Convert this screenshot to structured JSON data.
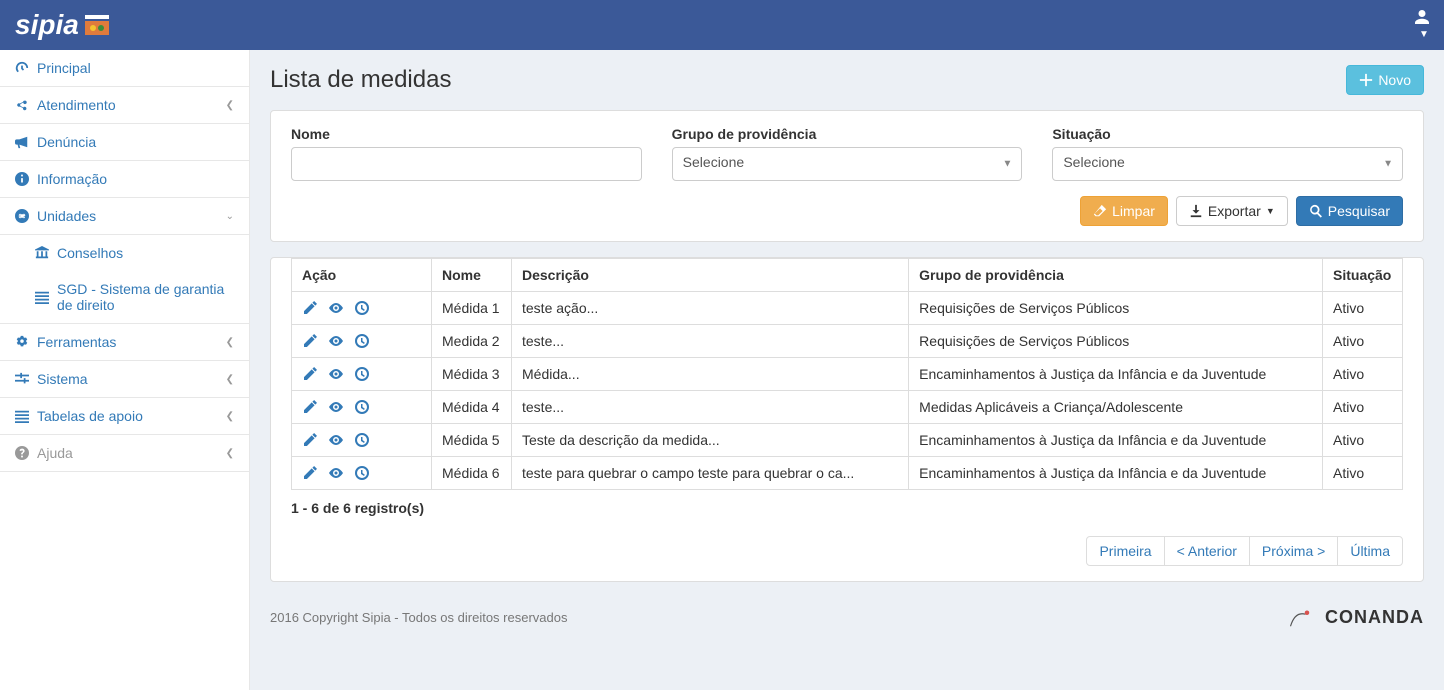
{
  "header": {
    "logo_text": "sipia"
  },
  "sidebar": {
    "principal": "Principal",
    "atendimento": "Atendimento",
    "denuncia": "Denúncia",
    "informacao": "Informação",
    "unidades": "Unidades",
    "conselhos": "Conselhos",
    "sgd": "SGD - Sistema de garantia de direito",
    "ferramentas": "Ferramentas",
    "sistema": "Sistema",
    "tabelas": "Tabelas de apoio",
    "ajuda": "Ajuda"
  },
  "page": {
    "title": "Lista de medidas",
    "novo": "Novo"
  },
  "filters": {
    "nome_label": "Nome",
    "grupo_label": "Grupo de providência",
    "situacao_label": "Situação",
    "select_placeholder": "Selecione",
    "limpar": "Limpar",
    "exportar": "Exportar",
    "pesquisar": "Pesquisar"
  },
  "table": {
    "headers": {
      "acao": "Ação",
      "nome": "Nome",
      "descricao": "Descrição",
      "grupo": "Grupo de providência",
      "situacao": "Situação"
    },
    "rows": [
      {
        "nome": "Médida 1",
        "descricao": "teste ação...",
        "grupo": "Requisições de Serviços Públicos",
        "situacao": "Ativo"
      },
      {
        "nome": "Medida 2",
        "descricao": "teste...",
        "grupo": "Requisições de Serviços Públicos",
        "situacao": "Ativo"
      },
      {
        "nome": "Médida 3",
        "descricao": "Médida...",
        "grupo": "Encaminhamentos à Justiça da Infância e da Juventude",
        "situacao": "Ativo"
      },
      {
        "nome": "Médida 4",
        "descricao": "teste...",
        "grupo": "Medidas Aplicáveis a Criança/Adolescente",
        "situacao": "Ativo"
      },
      {
        "nome": "Médida 5",
        "descricao": "Teste da descrição da medida...",
        "grupo": "Encaminhamentos à Justiça da Infância e da Juventude",
        "situacao": "Ativo"
      },
      {
        "nome": "Médida 6",
        "descricao": "teste para quebrar o campo teste para quebrar o ca...",
        "grupo": "Encaminhamentos à Justiça da Infância e da Juventude",
        "situacao": "Ativo"
      }
    ]
  },
  "pagination": {
    "info": "1 - 6 de 6 registro(s)",
    "primeira": "Primeira",
    "anterior": "< Anterior",
    "proxima": "Próxima >",
    "ultima": "Última"
  },
  "footer": {
    "copyright": "2016 Copyright Sipia - Todos os direitos reservados",
    "conanda": "CONANDA"
  }
}
